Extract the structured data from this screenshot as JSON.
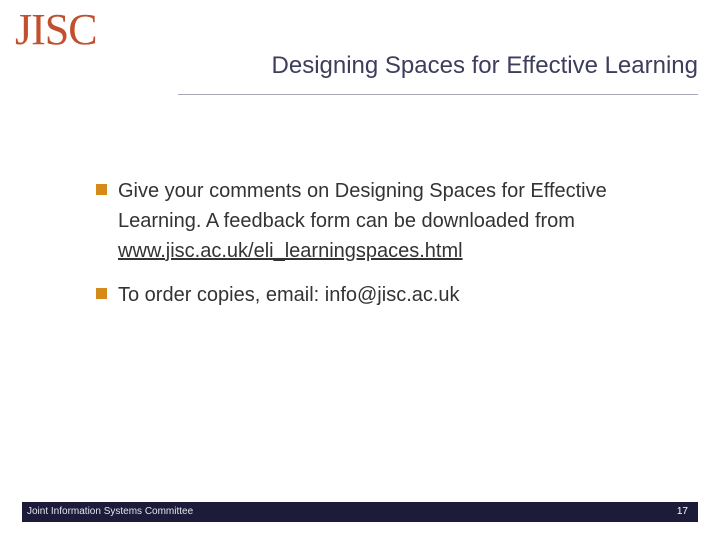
{
  "header": {
    "logo": "JISC",
    "title": "Designing Spaces for Effective Learning"
  },
  "bullets": {
    "item1_text": "Give your comments on Designing Spaces for Effective Learning. A feedback form can be downloaded from",
    "item1_link": "www.jisc.ac.uk/eli_learningspaces.html",
    "item2_text": "To order copies, email: info@jisc.ac.uk"
  },
  "footer": {
    "organization": "Joint Information Systems Committee",
    "page_number": "17"
  },
  "colors": {
    "accent": "#d68a1a",
    "logo": "#c1502e",
    "footer_bar": "#1c1c3a"
  }
}
